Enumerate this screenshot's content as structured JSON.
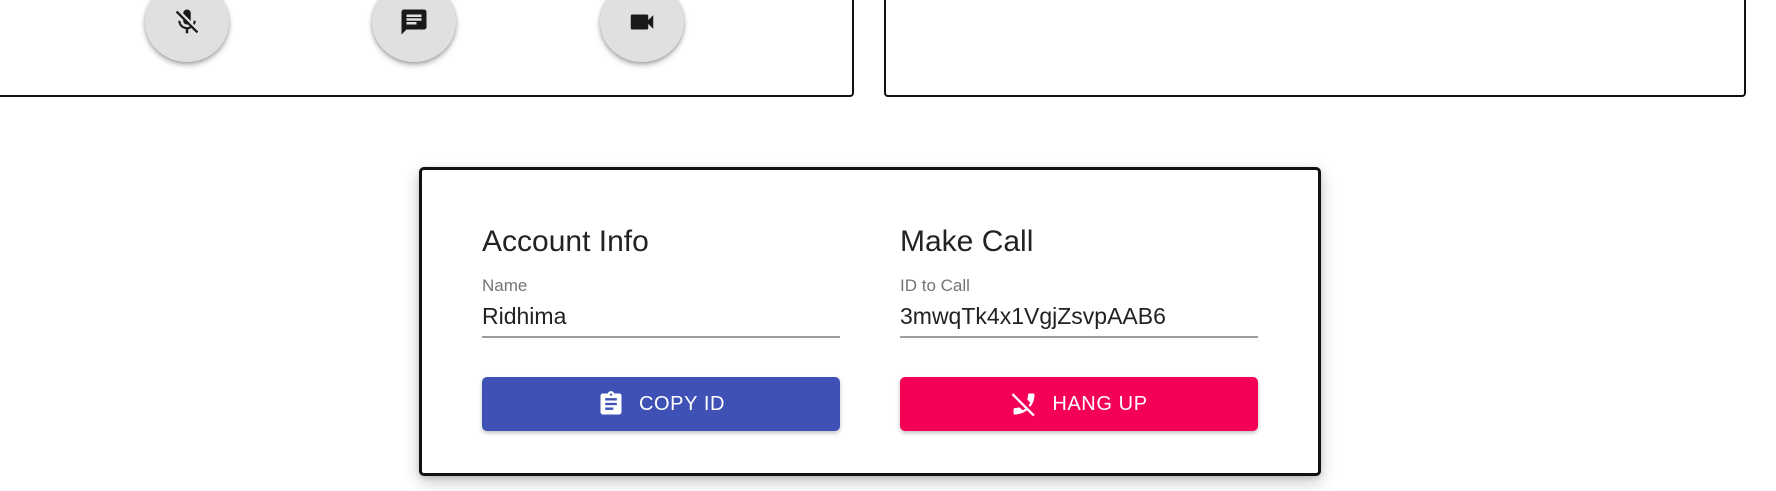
{
  "controls": {
    "mic": {
      "icon": "mic-off-icon"
    },
    "chat": {
      "icon": "chat-icon"
    },
    "video": {
      "icon": "videocam-icon"
    }
  },
  "account": {
    "title": "Account Info",
    "name_label": "Name",
    "name_value": "Ridhima",
    "copy_button": {
      "label": "COPY ID",
      "icon": "clipboard-icon",
      "color": "#3f51b5"
    }
  },
  "call": {
    "title": "Make Call",
    "id_label": "ID to Call",
    "id_value": "3mwqTk4x1VgjZsvpAAB6",
    "hangup_button": {
      "label": "HANG UP",
      "icon": "phone-disabled-icon",
      "color": "#f50057"
    }
  }
}
